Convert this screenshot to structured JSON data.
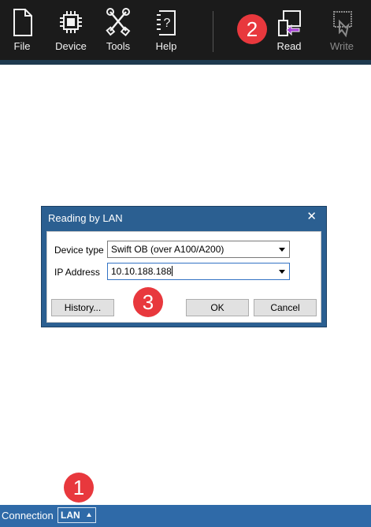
{
  "toolbar": {
    "buttons": [
      {
        "label": "File",
        "icon": "file-icon"
      },
      {
        "label": "Device",
        "icon": "chip-icon"
      },
      {
        "label": "Tools",
        "icon": "tools-icon"
      },
      {
        "label": "Help",
        "icon": "help-icon"
      },
      {
        "label": "Read",
        "icon": "read-icon"
      },
      {
        "label": "Write",
        "icon": "write-icon",
        "disabled": true
      }
    ]
  },
  "markers": {
    "one": "1",
    "two": "2",
    "three": "3"
  },
  "dialog": {
    "title": "Reading by LAN",
    "close": "✕",
    "device_type_label": "Device type",
    "device_type_value": "Swift OB (over A100/A200)",
    "ip_address_label": "IP Address",
    "ip_address_value": "10.10.188.188",
    "history_button": "History...",
    "ok_button": "OK",
    "cancel_button": "Cancel"
  },
  "statusbar": {
    "connection_label": "Connection",
    "connection_value": "LAN"
  },
  "colors": {
    "toolbar_bg": "#1b1b1b",
    "dialog_title_bg": "#2b5f91",
    "statusbar_bg": "#2f6aa8",
    "marker": "#e8383d",
    "read_arrow": "#a640d6"
  }
}
